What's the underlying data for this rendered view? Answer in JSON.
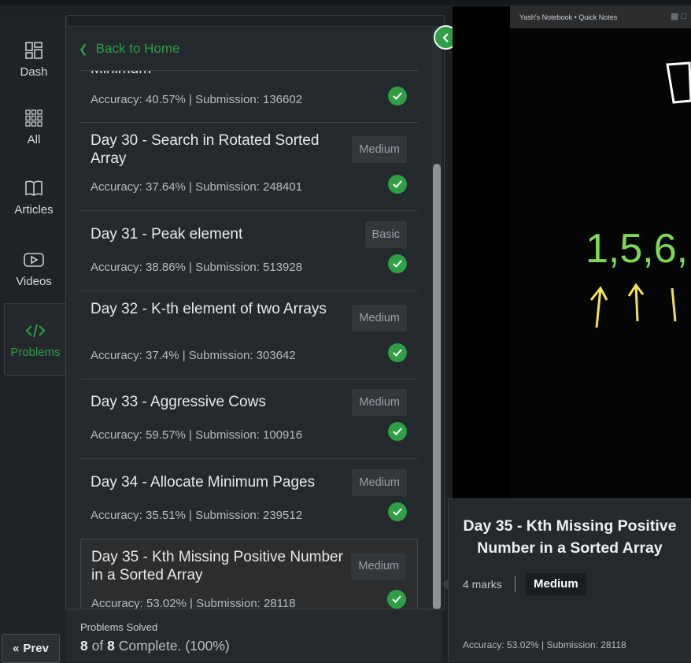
{
  "sidebar": {
    "items": [
      {
        "label": "Dash",
        "icon": "dashboard-icon"
      },
      {
        "label": "All",
        "icon": "grid-icon"
      },
      {
        "label": "Articles",
        "icon": "book-icon"
      },
      {
        "label": "Videos",
        "icon": "video-icon"
      },
      {
        "label": "Problems",
        "icon": "code-icon",
        "active": true
      }
    ]
  },
  "panel": {
    "back_label": "Back to Home",
    "partial_title": "Minimum",
    "partial_meta": "Accuracy: 40.57% | Submission: 136602",
    "items": [
      {
        "title": "Day 30 - Search in Rotated Sorted Array",
        "difficulty": "Medium",
        "meta": "Accuracy: 37.64% | Submission: 248401"
      },
      {
        "title": "Day 31 - Peak element",
        "difficulty": "Basic",
        "meta": "Accuracy: 38.86% | Submission: 513928"
      },
      {
        "title": "Day 32 - K-th element of two Arrays",
        "difficulty": "Medium",
        "meta": "Accuracy: 37.4% | Submission: 303642"
      },
      {
        "title": "Day 33 - Aggressive Cows",
        "difficulty": "Medium",
        "meta": "Accuracy: 59.57% | Submission: 100916"
      },
      {
        "title": "Day 34 - Allocate Minimum Pages",
        "difficulty": "Medium",
        "meta": "Accuracy: 35.51% | Submission: 239512"
      },
      {
        "title": "Day 35 - Kth Missing Positive Number in a Sorted Array",
        "difficulty": "Medium",
        "meta": "Accuracy: 53.02% | Submission: 28118"
      }
    ]
  },
  "progress": {
    "label": "Problems Solved",
    "solved": "8",
    "of_text": "of",
    "total": "8",
    "suffix": "Complete. (100%)"
  },
  "prev_label": "Prev",
  "video": {
    "notebook_title": "Yash's Notebook • Quick Notes",
    "board_text": "1,5,6,"
  },
  "card": {
    "title": "Day 35 - Kth Missing Positive Number in a Sorted Array",
    "marks": "4 marks",
    "difficulty": "Medium",
    "meta": "Accuracy: 53.02% | Submission: 28118"
  },
  "colors": {
    "accent": "#2f9e44",
    "background": "#1d2125",
    "panel": "#24292d"
  }
}
